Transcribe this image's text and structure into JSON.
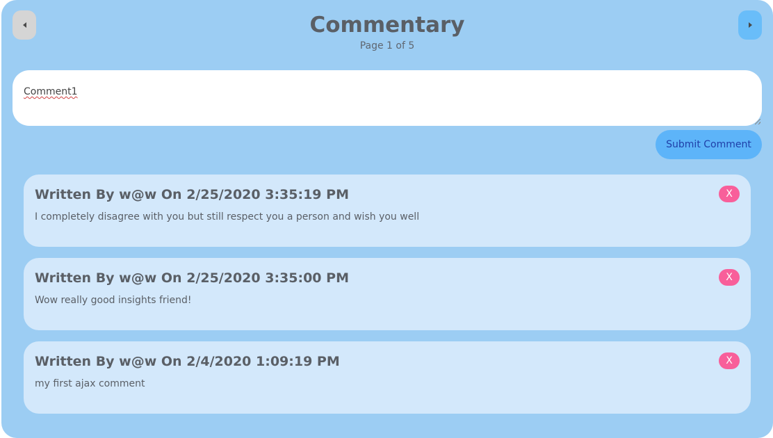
{
  "header": {
    "title": "Commentary",
    "page_info": "Page 1 of 5",
    "prev_icon": "chevron-left-icon",
    "next_icon": "chevron-right-icon"
  },
  "comment_input": {
    "value": "Comment1"
  },
  "submit_label": "Submit Comment",
  "comments": [
    {
      "header": "Written By w@w On 2/25/2020 3:35:19 PM",
      "body": "I completely disagree with you but still respect you a person and wish you well",
      "delete_label": "X"
    },
    {
      "header": "Written By w@w On 2/25/2020 3:35:00 PM",
      "body": "Wow really good insights friend!",
      "delete_label": "X"
    },
    {
      "header": "Written By w@w On 2/4/2020 1:09:19 PM",
      "body": "my first ajax comment",
      "delete_label": "X"
    }
  ],
  "colors": {
    "panel_bg": "#9ccdf3",
    "card_bg": "#d3e8fb",
    "prev_button": "#d5d5d5",
    "next_button": "#69bdf9",
    "submit_button": "#5db4f9",
    "delete_button": "#f85f9a"
  }
}
